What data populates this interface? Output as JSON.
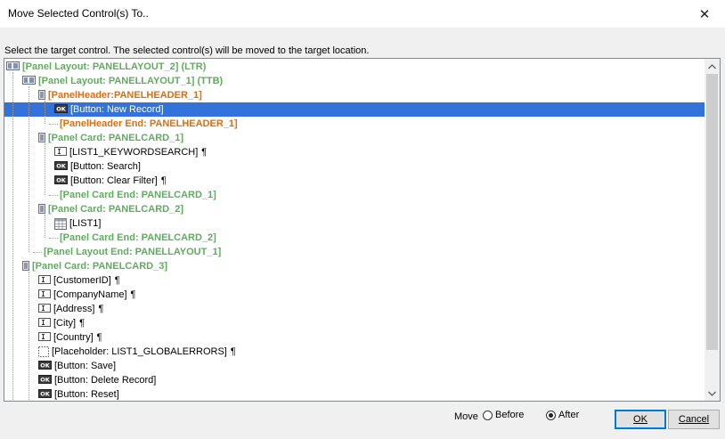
{
  "window": {
    "title": "Move Selected Control(s) To..",
    "close_glyph": "✕"
  },
  "instruction": "Select the target control. The selected control(s) will be moved to the target location.",
  "tree": [
    {
      "depth": 0,
      "icon": "panel-layout-icon",
      "text": "[Panel Layout: PANELLAYOUT_2] (LTR)",
      "style": "green"
    },
    {
      "depth": 1,
      "icon": "panel-layout-icon",
      "text": "[Panel Layout: PANELLAYOUT_1] (TTB)",
      "style": "green"
    },
    {
      "depth": 2,
      "icon": "panel-icon",
      "text": "[PanelHeader:PANELHEADER_1]",
      "style": "orange"
    },
    {
      "depth": 3,
      "icon": "button-ok-icon",
      "text": "[Button: New Record]",
      "style": "plain",
      "selected": true
    },
    {
      "depth": 3,
      "icon": "",
      "text": "[PanelHeader End: PANELHEADER_1]",
      "style": "orange"
    },
    {
      "depth": 2,
      "icon": "panel-icon",
      "text": "[Panel Card: PANELCARD_1]",
      "style": "green"
    },
    {
      "depth": 3,
      "icon": "textbox-icon",
      "text": "[LIST1_KEYWORDSEARCH]",
      "style": "plain",
      "pilcrow": "¶"
    },
    {
      "depth": 3,
      "icon": "button-ok-icon",
      "text": "[Button: Search]",
      "style": "plain"
    },
    {
      "depth": 3,
      "icon": "button-ok-icon",
      "text": "[Button: Clear Filter]",
      "style": "plain",
      "pilcrow": "¶"
    },
    {
      "depth": 3,
      "icon": "",
      "text": "[Panel Card End: PANELCARD_1]",
      "style": "green"
    },
    {
      "depth": 2,
      "icon": "panel-icon",
      "text": "[Panel Card: PANELCARD_2]",
      "style": "green"
    },
    {
      "depth": 3,
      "icon": "grid-icon",
      "text": "[LIST1]",
      "style": "plain"
    },
    {
      "depth": 3,
      "icon": "",
      "text": "[Panel Card End: PANELCARD_2]",
      "style": "green"
    },
    {
      "depth": 2,
      "icon": "",
      "text": "[Panel Layout End: PANELLAYOUT_1]",
      "style": "green"
    },
    {
      "depth": 1,
      "icon": "panel-icon",
      "text": "[Panel Card: PANELCARD_3]",
      "style": "green"
    },
    {
      "depth": 2,
      "icon": "textbox-icon",
      "text": "[CustomerID]",
      "style": "plain",
      "pilcrow": "¶"
    },
    {
      "depth": 2,
      "icon": "textbox-icon",
      "text": "[CompanyName]",
      "style": "plain",
      "pilcrow": "¶"
    },
    {
      "depth": 2,
      "icon": "textbox-icon",
      "text": "[Address]",
      "style": "plain",
      "pilcrow": "¶"
    },
    {
      "depth": 2,
      "icon": "textbox-icon",
      "text": "[City]",
      "style": "plain",
      "pilcrow": "¶"
    },
    {
      "depth": 2,
      "icon": "textbox-icon",
      "text": "[Country]",
      "style": "plain",
      "pilcrow": "¶"
    },
    {
      "depth": 2,
      "icon": "placeholder-icon",
      "text": "[Placeholder: LIST1_GLOBALERRORS]",
      "style": "plain",
      "pilcrow": "¶"
    },
    {
      "depth": 2,
      "icon": "button-ok-icon",
      "text": "[Button: Save]",
      "style": "plain"
    },
    {
      "depth": 2,
      "icon": "button-ok-icon",
      "text": "[Button: Delete Record]",
      "style": "plain"
    },
    {
      "depth": 2,
      "icon": "button-ok-icon",
      "text": "[Button: Reset]",
      "style": "plain"
    }
  ],
  "ok_icon_label": "OK",
  "move": {
    "label": "Move",
    "before_label": "Before",
    "after_label": "After",
    "selected": "After"
  },
  "buttons": {
    "ok": "OK",
    "cancel": "Cancel"
  },
  "colors": {
    "green": "#5fac5f",
    "orange": "#e36c0a",
    "selection": "#3272d9"
  }
}
